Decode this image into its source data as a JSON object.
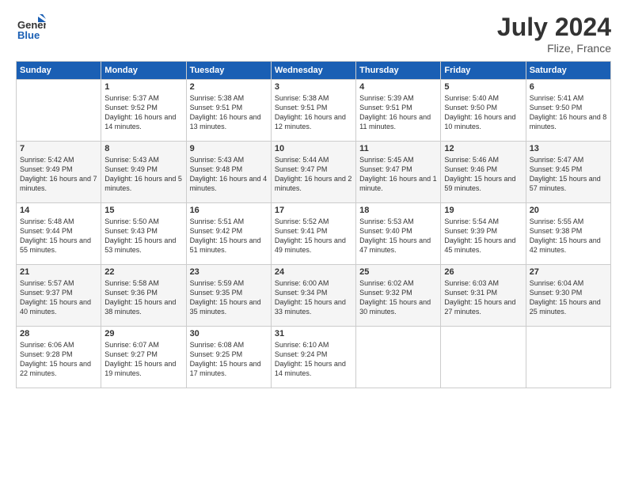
{
  "header": {
    "logo_line1": "General",
    "logo_line2": "Blue",
    "month": "July 2024",
    "location": "Flize, France"
  },
  "days_of_week": [
    "Sunday",
    "Monday",
    "Tuesday",
    "Wednesday",
    "Thursday",
    "Friday",
    "Saturday"
  ],
  "weeks": [
    [
      {
        "num": "",
        "sunrise": "",
        "sunset": "",
        "daylight": ""
      },
      {
        "num": "1",
        "sunrise": "Sunrise: 5:37 AM",
        "sunset": "Sunset: 9:52 PM",
        "daylight": "Daylight: 16 hours and 14 minutes."
      },
      {
        "num": "2",
        "sunrise": "Sunrise: 5:38 AM",
        "sunset": "Sunset: 9:51 PM",
        "daylight": "Daylight: 16 hours and 13 minutes."
      },
      {
        "num": "3",
        "sunrise": "Sunrise: 5:38 AM",
        "sunset": "Sunset: 9:51 PM",
        "daylight": "Daylight: 16 hours and 12 minutes."
      },
      {
        "num": "4",
        "sunrise": "Sunrise: 5:39 AM",
        "sunset": "Sunset: 9:51 PM",
        "daylight": "Daylight: 16 hours and 11 minutes."
      },
      {
        "num": "5",
        "sunrise": "Sunrise: 5:40 AM",
        "sunset": "Sunset: 9:50 PM",
        "daylight": "Daylight: 16 hours and 10 minutes."
      },
      {
        "num": "6",
        "sunrise": "Sunrise: 5:41 AM",
        "sunset": "Sunset: 9:50 PM",
        "daylight": "Daylight: 16 hours and 8 minutes."
      }
    ],
    [
      {
        "num": "7",
        "sunrise": "Sunrise: 5:42 AM",
        "sunset": "Sunset: 9:49 PM",
        "daylight": "Daylight: 16 hours and 7 minutes."
      },
      {
        "num": "8",
        "sunrise": "Sunrise: 5:43 AM",
        "sunset": "Sunset: 9:49 PM",
        "daylight": "Daylight: 16 hours and 5 minutes."
      },
      {
        "num": "9",
        "sunrise": "Sunrise: 5:43 AM",
        "sunset": "Sunset: 9:48 PM",
        "daylight": "Daylight: 16 hours and 4 minutes."
      },
      {
        "num": "10",
        "sunrise": "Sunrise: 5:44 AM",
        "sunset": "Sunset: 9:47 PM",
        "daylight": "Daylight: 16 hours and 2 minutes."
      },
      {
        "num": "11",
        "sunrise": "Sunrise: 5:45 AM",
        "sunset": "Sunset: 9:47 PM",
        "daylight": "Daylight: 16 hours and 1 minute."
      },
      {
        "num": "12",
        "sunrise": "Sunrise: 5:46 AM",
        "sunset": "Sunset: 9:46 PM",
        "daylight": "Daylight: 15 hours and 59 minutes."
      },
      {
        "num": "13",
        "sunrise": "Sunrise: 5:47 AM",
        "sunset": "Sunset: 9:45 PM",
        "daylight": "Daylight: 15 hours and 57 minutes."
      }
    ],
    [
      {
        "num": "14",
        "sunrise": "Sunrise: 5:48 AM",
        "sunset": "Sunset: 9:44 PM",
        "daylight": "Daylight: 15 hours and 55 minutes."
      },
      {
        "num": "15",
        "sunrise": "Sunrise: 5:50 AM",
        "sunset": "Sunset: 9:43 PM",
        "daylight": "Daylight: 15 hours and 53 minutes."
      },
      {
        "num": "16",
        "sunrise": "Sunrise: 5:51 AM",
        "sunset": "Sunset: 9:42 PM",
        "daylight": "Daylight: 15 hours and 51 minutes."
      },
      {
        "num": "17",
        "sunrise": "Sunrise: 5:52 AM",
        "sunset": "Sunset: 9:41 PM",
        "daylight": "Daylight: 15 hours and 49 minutes."
      },
      {
        "num": "18",
        "sunrise": "Sunrise: 5:53 AM",
        "sunset": "Sunset: 9:40 PM",
        "daylight": "Daylight: 15 hours and 47 minutes."
      },
      {
        "num": "19",
        "sunrise": "Sunrise: 5:54 AM",
        "sunset": "Sunset: 9:39 PM",
        "daylight": "Daylight: 15 hours and 45 minutes."
      },
      {
        "num": "20",
        "sunrise": "Sunrise: 5:55 AM",
        "sunset": "Sunset: 9:38 PM",
        "daylight": "Daylight: 15 hours and 42 minutes."
      }
    ],
    [
      {
        "num": "21",
        "sunrise": "Sunrise: 5:57 AM",
        "sunset": "Sunset: 9:37 PM",
        "daylight": "Daylight: 15 hours and 40 minutes."
      },
      {
        "num": "22",
        "sunrise": "Sunrise: 5:58 AM",
        "sunset": "Sunset: 9:36 PM",
        "daylight": "Daylight: 15 hours and 38 minutes."
      },
      {
        "num": "23",
        "sunrise": "Sunrise: 5:59 AM",
        "sunset": "Sunset: 9:35 PM",
        "daylight": "Daylight: 15 hours and 35 minutes."
      },
      {
        "num": "24",
        "sunrise": "Sunrise: 6:00 AM",
        "sunset": "Sunset: 9:34 PM",
        "daylight": "Daylight: 15 hours and 33 minutes."
      },
      {
        "num": "25",
        "sunrise": "Sunrise: 6:02 AM",
        "sunset": "Sunset: 9:32 PM",
        "daylight": "Daylight: 15 hours and 30 minutes."
      },
      {
        "num": "26",
        "sunrise": "Sunrise: 6:03 AM",
        "sunset": "Sunset: 9:31 PM",
        "daylight": "Daylight: 15 hours and 27 minutes."
      },
      {
        "num": "27",
        "sunrise": "Sunrise: 6:04 AM",
        "sunset": "Sunset: 9:30 PM",
        "daylight": "Daylight: 15 hours and 25 minutes."
      }
    ],
    [
      {
        "num": "28",
        "sunrise": "Sunrise: 6:06 AM",
        "sunset": "Sunset: 9:28 PM",
        "daylight": "Daylight: 15 hours and 22 minutes."
      },
      {
        "num": "29",
        "sunrise": "Sunrise: 6:07 AM",
        "sunset": "Sunset: 9:27 PM",
        "daylight": "Daylight: 15 hours and 19 minutes."
      },
      {
        "num": "30",
        "sunrise": "Sunrise: 6:08 AM",
        "sunset": "Sunset: 9:25 PM",
        "daylight": "Daylight: 15 hours and 17 minutes."
      },
      {
        "num": "31",
        "sunrise": "Sunrise: 6:10 AM",
        "sunset": "Sunset: 9:24 PM",
        "daylight": "Daylight: 15 hours and 14 minutes."
      },
      {
        "num": "",
        "sunrise": "",
        "sunset": "",
        "daylight": ""
      },
      {
        "num": "",
        "sunrise": "",
        "sunset": "",
        "daylight": ""
      },
      {
        "num": "",
        "sunrise": "",
        "sunset": "",
        "daylight": ""
      }
    ]
  ]
}
